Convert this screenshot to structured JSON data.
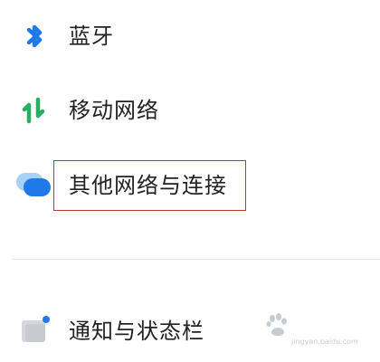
{
  "settings": {
    "items": [
      {
        "label": "蓝牙",
        "icon": "bluetooth-icon",
        "icon_color": "#1f7ae8"
      },
      {
        "label": "移动网络",
        "icon": "mobile-data-arrows-icon",
        "icon_color": "#27ae60"
      },
      {
        "label": "其他网络与连接",
        "icon": "connections-bubble-icon",
        "icon_color": "#1f7ae8",
        "highlighted": true
      },
      {
        "label": "通知与状态栏",
        "icon": "notification-icon",
        "icon_color": "#cfd3d8"
      }
    ]
  },
  "colors": {
    "highlight_border": "#c0392b",
    "divider": "#e6e6e6"
  },
  "watermark": {
    "text": "jingyan.baidu.com",
    "icon": "baidu-paw-logo"
  }
}
